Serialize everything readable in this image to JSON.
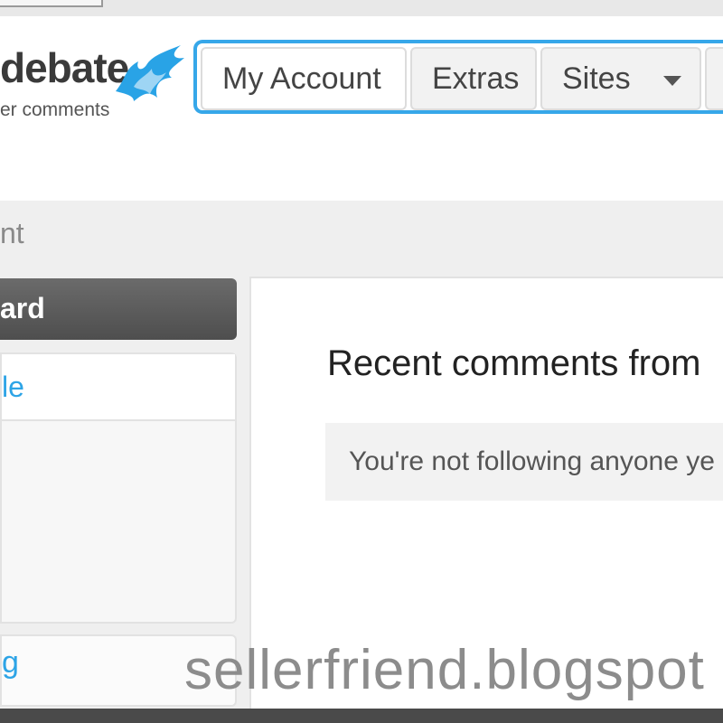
{
  "logo": {
    "word": "debate",
    "tagline": "er comments",
    "accent": "#29a3e6"
  },
  "tabs": [
    {
      "label": "My Account"
    },
    {
      "label": "Extras"
    },
    {
      "label": "Sites"
    }
  ],
  "breadcrumb": "nt",
  "sidebar": {
    "active_label": "ard",
    "link_1": "le",
    "link_2": "g"
  },
  "main": {
    "title": "Recent comments from",
    "empty_message": "You're not following anyone ye"
  },
  "watermark": "sellerfriend.blogspot",
  "colors": {
    "tab_border": "#36a7e9",
    "link": "#2da4e6"
  }
}
